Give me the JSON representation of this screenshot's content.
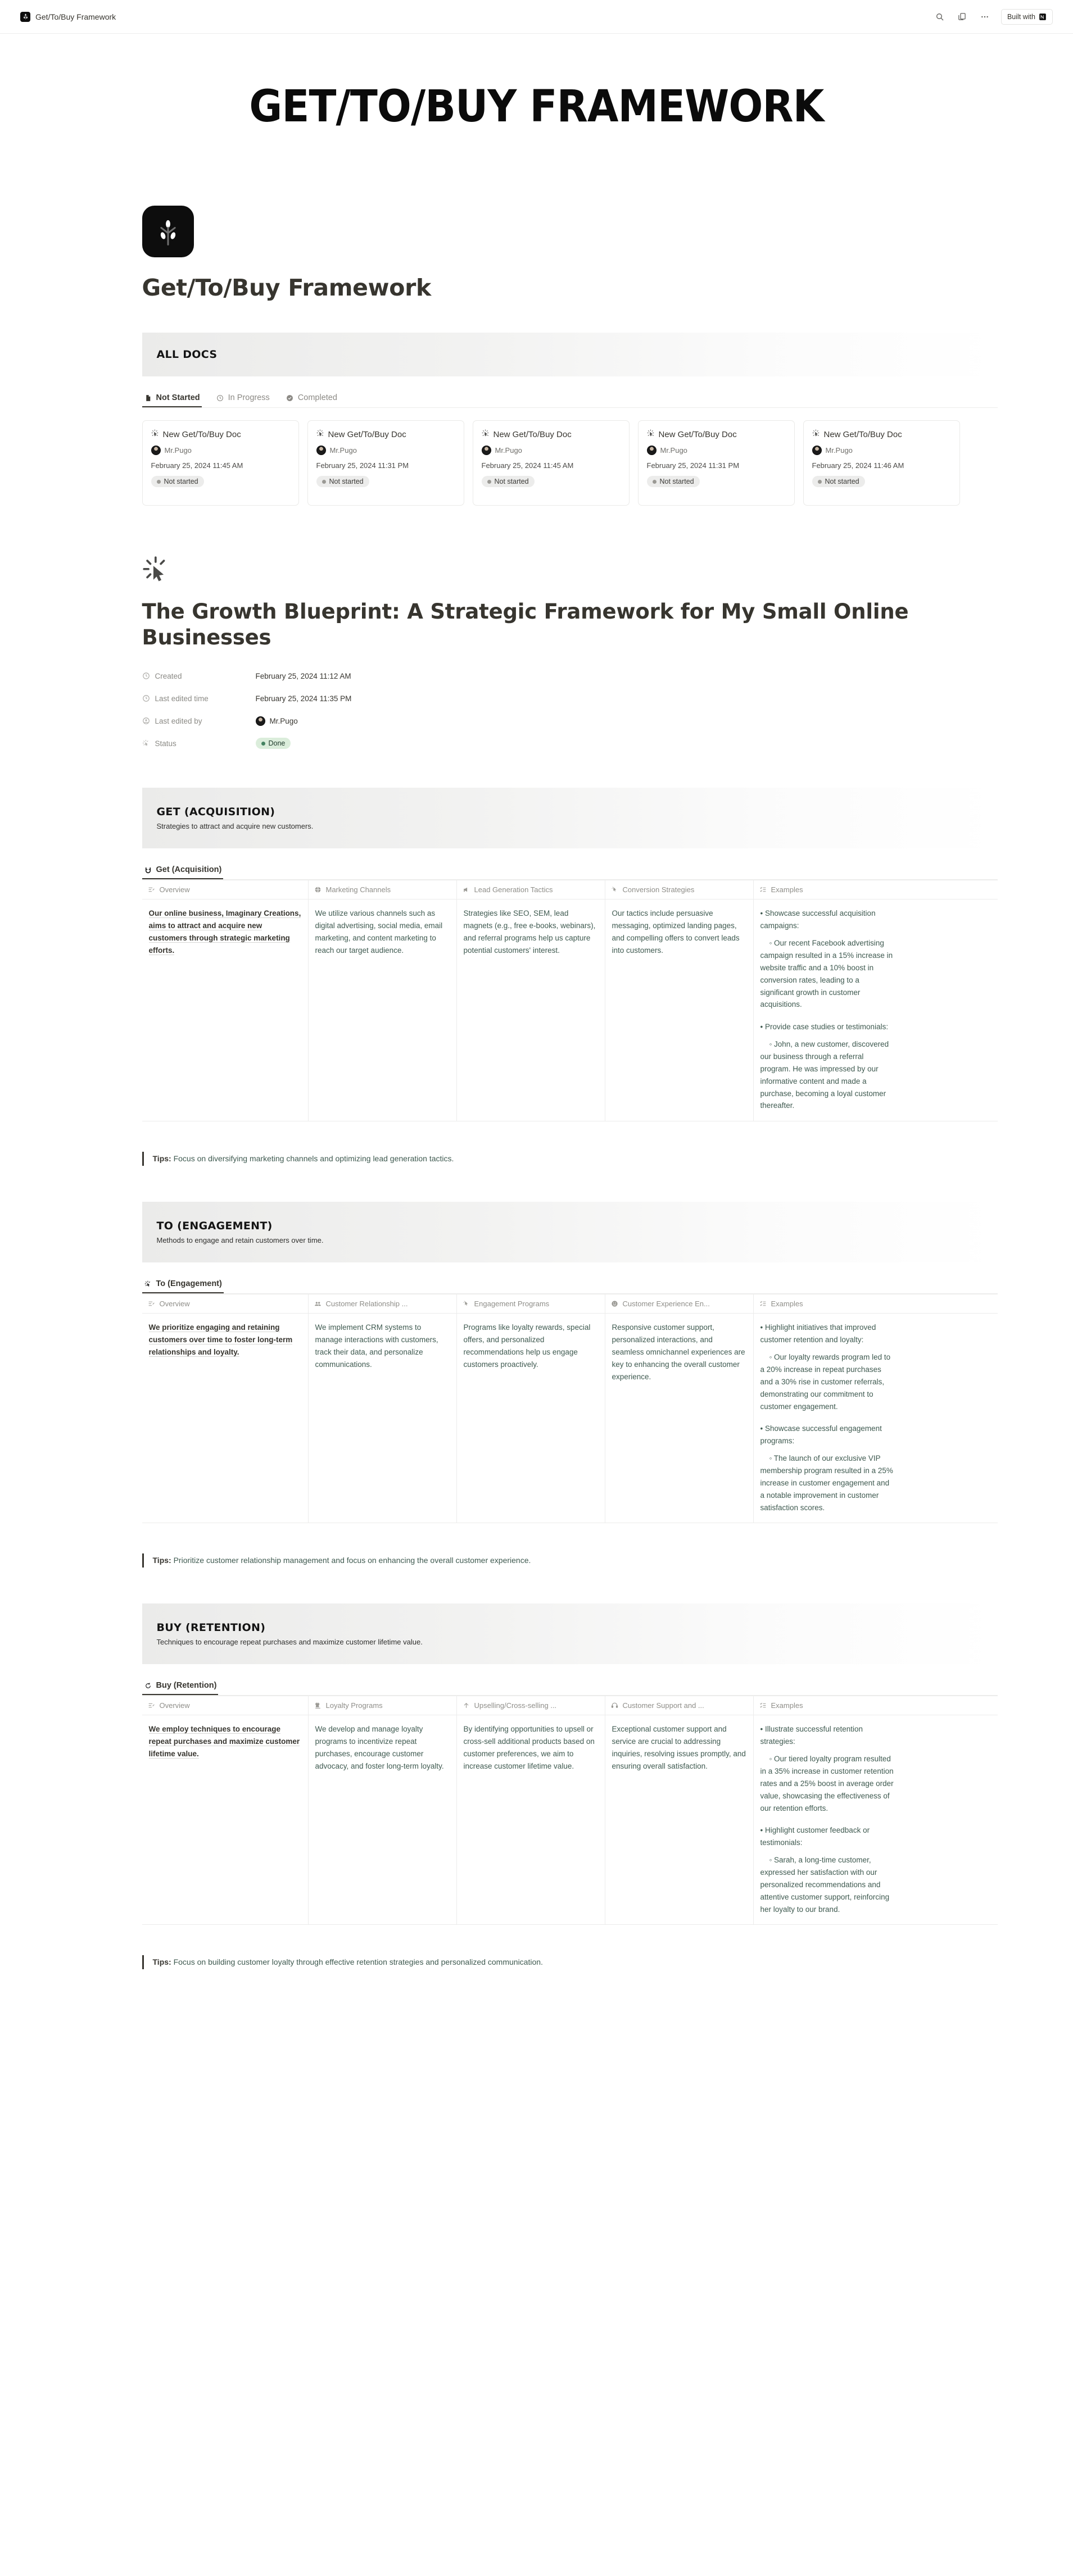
{
  "topbar": {
    "app_title": "Get/To/Buy Framework",
    "search_icon": "search-icon",
    "duplicate_icon": "duplicate-icon",
    "more_icon": "more-horizontal-icon",
    "built_with_label": "Built with"
  },
  "cover": {
    "text": "GET/TO/BUY FRAMEWORK"
  },
  "database": {
    "icon": "sprout-logo-icon",
    "title": "Get/To/Buy Framework",
    "banner": {
      "title": "ALL DOCS"
    },
    "tabs": [
      {
        "label": "Not Started",
        "icon": "document-icon",
        "active": true
      },
      {
        "label": "In Progress",
        "icon": "clock-icon",
        "active": false
      },
      {
        "label": "Completed",
        "icon": "check-circle-icon",
        "active": false
      }
    ],
    "cards": [
      {
        "title": "New Get/To/Buy Doc",
        "author": "Mr.Pugo",
        "date": "February 25, 2024 11:45 AM",
        "status": "Not started"
      },
      {
        "title": "New Get/To/Buy Doc",
        "author": "Mr.Pugo",
        "date": "February 25, 2024 11:31 PM",
        "status": "Not started"
      },
      {
        "title": "New Get/To/Buy Doc",
        "author": "Mr.Pugo",
        "date": "February 25, 2024 11:45 AM",
        "status": "Not started"
      },
      {
        "title": "New Get/To/Buy Doc",
        "author": "Mr.Pugo",
        "date": "February 25, 2024 11:31 PM",
        "status": "Not started"
      },
      {
        "title": "New Get/To/Buy Doc",
        "author": "Mr.Pugo",
        "date": "February 25, 2024 11:46 AM",
        "status": "Not started"
      }
    ]
  },
  "doc": {
    "icon": "click-cursor-icon",
    "title": "The Growth Blueprint: A Strategic Framework for My Small Online Businesses",
    "properties": [
      {
        "label": "Created",
        "icon": "clock-icon",
        "value": "February 25, 2024 11:12 AM"
      },
      {
        "label": "Last edited time",
        "icon": "clock-icon",
        "value": "February 25, 2024 11:35 PM"
      },
      {
        "label": "Last edited by",
        "icon": "person-icon",
        "value": "Mr.Pugo"
      },
      {
        "label": "Status",
        "icon": "click-cursor-icon",
        "value": "Done"
      }
    ]
  },
  "sections": [
    {
      "banner_title": "GET (ACQUISITION)",
      "banner_sub": "Strategies to attract and acquire new customers.",
      "tab_label": "Get (Acquisition)",
      "tab_icon": "magnet-icon",
      "columns": [
        {
          "label": "Overview",
          "icon": "overview-icon"
        },
        {
          "label": "Marketing Channels",
          "icon": "globe-icon"
        },
        {
          "label": "Lead Generation Tactics",
          "icon": "megaphone-icon"
        },
        {
          "label": "Conversion Strategies",
          "icon": "click-cursor-icon"
        },
        {
          "label": "Examples",
          "icon": "checklist-icon"
        }
      ],
      "cells": [
        "Our online business, Imaginary Creations, aims to attract and acquire new customers through strategic marketing efforts.",
        "We utilize various channels such as digital advertising, social media, email marketing, and content marketing to reach our target audience.",
        "Strategies like SEO, SEM, lead magnets (e.g., free e-books, webinars), and referral programs help us capture potential customers' interest.",
        "Our tactics include persuasive messaging, optimized landing pages, and compelling offers to convert leads into customers."
      ],
      "examples": [
        {
          "bullet": "• Showcase successful acquisition campaigns:",
          "sub": "◦ Our recent Facebook advertising campaign resulted in a 15% increase in website traffic and a 10% boost in conversion rates, leading to a significant growth in customer acquisitions."
        },
        {
          "bullet": "• Provide case studies or testimonials:",
          "sub": "◦ John, a new customer, discovered our business through a referral program. He was impressed by our informative content and made a purchase, becoming a loyal customer thereafter."
        }
      ],
      "tips_label": "Tips:",
      "tips_text": " Focus on diversifying marketing channels and optimizing lead generation tactics."
    },
    {
      "banner_title": "TO (ENGAGEMENT)",
      "banner_sub": "Methods to engage and retain customers over time.",
      "tab_label": "To (Engagement)",
      "tab_icon": "click-cursor-icon",
      "columns": [
        {
          "label": "Overview",
          "icon": "overview-icon"
        },
        {
          "label": "Customer Relationship ...",
          "icon": "people-icon"
        },
        {
          "label": "Engagement Programs",
          "icon": "click-cursor-icon"
        },
        {
          "label": "Customer Experience En...",
          "icon": "smiley-icon"
        },
        {
          "label": "Examples",
          "icon": "checklist-icon"
        }
      ],
      "cells": [
        "We prioritize engaging and retaining customers over time to foster long-term relationships and loyalty.",
        "We implement CRM systems to manage interactions with customers, track their data, and personalize communications.",
        "Programs like loyalty rewards, special offers, and personalized recommendations help us engage customers proactively.",
        "Responsive customer support, personalized interactions, and seamless omnichannel experiences are key to enhancing the overall customer experience."
      ],
      "examples": [
        {
          "bullet": "• Highlight initiatives that improved customer retention and loyalty:",
          "sub": "◦ Our loyalty rewards program led to a 20% increase in repeat purchases and a 30% rise in customer referrals, demonstrating our commitment to customer engagement."
        },
        {
          "bullet": "• Showcase successful engagement programs:",
          "sub": "◦ The launch of our exclusive VIP membership program resulted in a 25% increase in customer engagement and a notable improvement in customer satisfaction scores."
        }
      ],
      "tips_label": "Tips:",
      "tips_text": " Prioritize customer relationship management and focus on enhancing the overall customer experience."
    },
    {
      "banner_title": "BUY (RETENTION)",
      "banner_sub": "Techniques to encourage repeat purchases and maximize customer lifetime value.",
      "tab_label": "Buy (Retention)",
      "tab_icon": "refresh-icon",
      "columns": [
        {
          "label": "Overview",
          "icon": "overview-icon"
        },
        {
          "label": "Loyalty Programs",
          "icon": "chess-rook-icon"
        },
        {
          "label": "Upselling/Cross-selling ...",
          "icon": "arrow-up-icon"
        },
        {
          "label": "Customer Support and ...",
          "icon": "headset-icon"
        },
        {
          "label": "Examples",
          "icon": "checklist-icon"
        }
      ],
      "cells": [
        "We employ techniques to encourage repeat purchases and maximize customer lifetime value.",
        "We develop and manage loyalty programs to incentivize repeat purchases, encourage customer advocacy, and foster long-term loyalty.",
        "By identifying opportunities to upsell or cross-sell additional products based on customer preferences, we aim to increase customer lifetime value.",
        "Exceptional customer support and service are crucial to addressing inquiries, resolving issues promptly, and ensuring overall satisfaction."
      ],
      "examples": [
        {
          "bullet": "• Illustrate successful retention strategies:",
          "sub": "◦ Our tiered loyalty program resulted in a 35% increase in customer retention rates and a 25% boost in average order value, showcasing the effectiveness of our retention efforts."
        },
        {
          "bullet": "• Highlight customer feedback or testimonials:",
          "sub": "◦ Sarah, a long-time customer, expressed her satisfaction with our personalized recommendations and attentive customer support, reinforcing her loyalty to our brand."
        }
      ],
      "tips_label": "Tips:",
      "tips_text": " Focus on building customer loyalty through effective retention strategies and personalized communication."
    }
  ]
}
